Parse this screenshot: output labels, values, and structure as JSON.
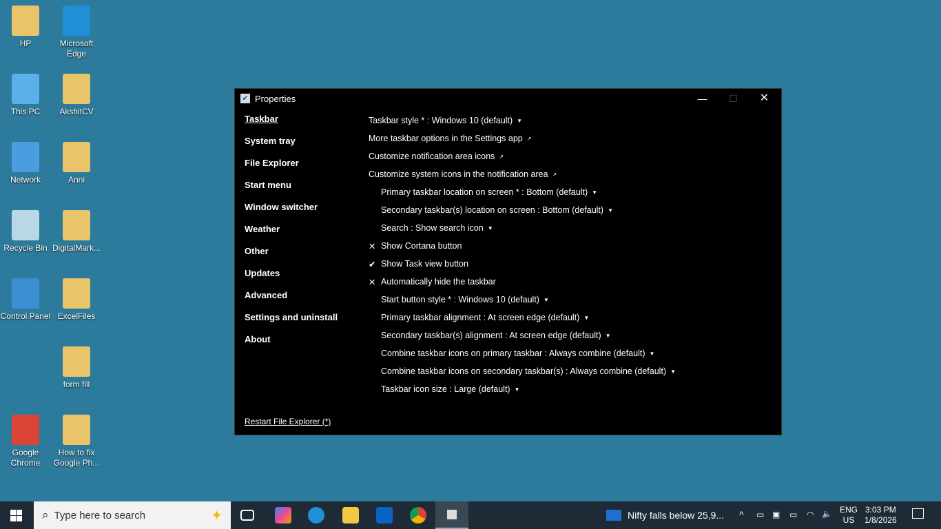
{
  "desktop": {
    "icons": [
      {
        "label": "HP",
        "color": "#e9c46a"
      },
      {
        "label": "Microsoft Edge",
        "color": "#1f8fd6"
      },
      {
        "label": "This PC",
        "color": "#5ab0e8"
      },
      {
        "label": "AkshitCV",
        "color": "#e9c46a"
      },
      {
        "label": "Network",
        "color": "#4a9ee0"
      },
      {
        "label": "Anni",
        "color": "#e9c46a"
      },
      {
        "label": "Recycle Bin",
        "color": "#b8d8e8"
      },
      {
        "label": "DigitalMark...",
        "color": "#e9c46a"
      },
      {
        "label": "Control Panel",
        "color": "#3a8fd0"
      },
      {
        "label": "ExcelFiles",
        "color": "#e9c46a"
      },
      {
        "label": "form fill",
        "color": "#e9c46a"
      },
      {
        "label": "Google Chrome",
        "color": "#db4437"
      },
      {
        "label": "How to fix Google Ph...",
        "color": "#e9c46a"
      }
    ]
  },
  "window": {
    "title": "Properties",
    "minimize": "—",
    "maximize": "☐",
    "close": "✕",
    "nav": [
      "Taskbar",
      "System tray",
      "File Explorer",
      "Start menu",
      "Window switcher",
      "Weather",
      "Other",
      "Updates",
      "Advanced",
      "Settings and uninstall",
      "About"
    ],
    "options": [
      {
        "text": "Taskbar style * : Windows 10 (default)",
        "suffix": "▼",
        "indent": false,
        "mark": ""
      },
      {
        "text": "More taskbar options in the Settings app",
        "suffix": "↗",
        "indent": false,
        "mark": ""
      },
      {
        "text": "Customize notification area icons",
        "suffix": "↗",
        "indent": false,
        "mark": ""
      },
      {
        "text": "Customize system icons in the notification area",
        "suffix": "↗",
        "indent": false,
        "mark": ""
      },
      {
        "text": "Primary taskbar location on screen * : Bottom (default)",
        "suffix": "▼",
        "indent": true,
        "mark": ""
      },
      {
        "text": "Secondary taskbar(s) location on screen : Bottom (default)",
        "suffix": "▼",
        "indent": true,
        "mark": ""
      },
      {
        "text": "Search : Show search icon",
        "suffix": "▼",
        "indent": true,
        "mark": ""
      },
      {
        "text": "Show Cortana button",
        "suffix": "",
        "indent": true,
        "mark": "✕"
      },
      {
        "text": "Show Task view button",
        "suffix": "",
        "indent": true,
        "mark": "✔"
      },
      {
        "text": "Automatically hide the taskbar",
        "suffix": "",
        "indent": true,
        "mark": "✕"
      },
      {
        "text": "Start button style * : Windows 10 (default)",
        "suffix": "▼",
        "indent": true,
        "mark": ""
      },
      {
        "text": "Primary taskbar alignment : At screen edge (default)",
        "suffix": "▼",
        "indent": true,
        "mark": ""
      },
      {
        "text": "Secondary taskbar(s) alignment : At screen edge (default)",
        "suffix": "▼",
        "indent": true,
        "mark": ""
      },
      {
        "text": "Combine taskbar icons on primary taskbar : Always combine (default)",
        "suffix": "▼",
        "indent": true,
        "mark": ""
      },
      {
        "text": "Combine taskbar icons on secondary taskbar(s) : Always combine (default)",
        "suffix": "▼",
        "indent": true,
        "mark": ""
      },
      {
        "text": "Taskbar icon size : Large (default)",
        "suffix": "▼",
        "indent": true,
        "mark": ""
      }
    ],
    "restart": "Restart File Explorer (*)"
  },
  "taskbar": {
    "search_placeholder": "Type here to search",
    "news": "Nifty falls below 25,9...",
    "lang1": "ENG",
    "lang2": "US",
    "time": "3:03 PM",
    "date": "1/8/2026"
  }
}
